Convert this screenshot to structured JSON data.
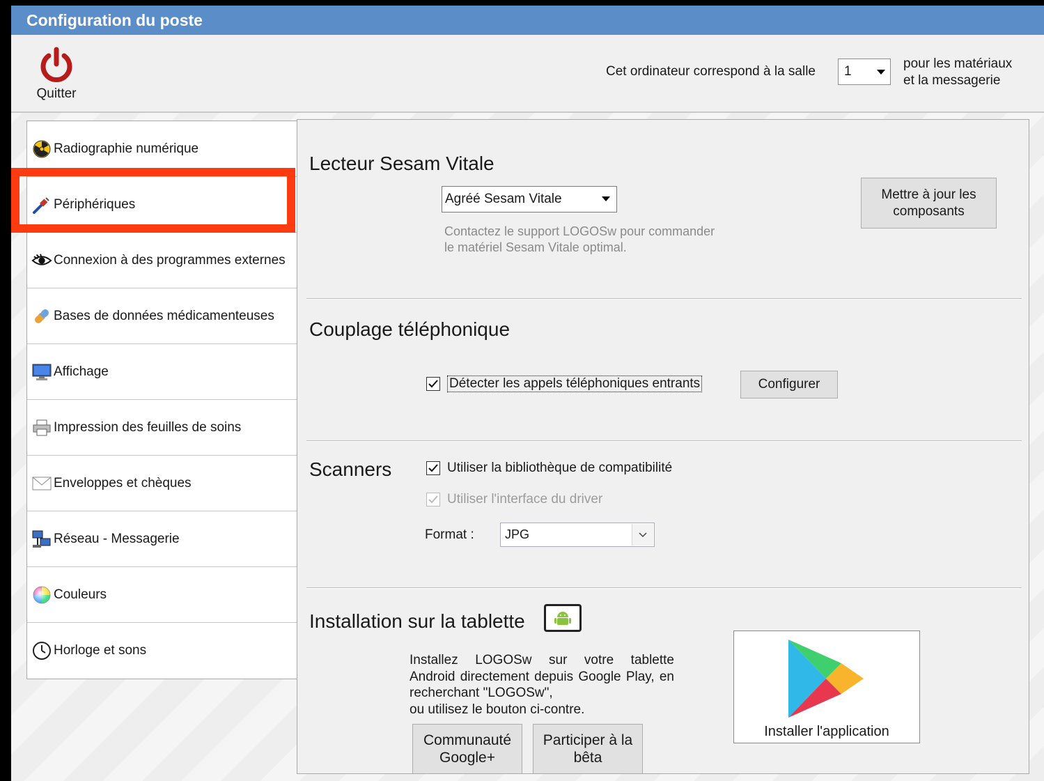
{
  "window": {
    "title": "Configuration du poste"
  },
  "toolbar": {
    "quit_label": "Quitter",
    "salle_text": "Cet ordinateur correspond à la salle",
    "salle_value": "1",
    "salle_after_line1": "pour les matériaux",
    "salle_after_line2": "et la messagerie"
  },
  "sidebar": {
    "items": [
      {
        "label": "Radiographie numérique",
        "icon": "radiation-icon"
      },
      {
        "label": "Périphériques",
        "icon": "plug-icon"
      },
      {
        "label": "Connexion à des programmes externes",
        "icon": "eye-icon"
      },
      {
        "label": "Bases de données médicamenteuses",
        "icon": "pill-icon"
      },
      {
        "label": "Affichage",
        "icon": "monitor-icon"
      },
      {
        "label": "Impression des feuilles de soins",
        "icon": "printer-icon"
      },
      {
        "label": "Enveloppes et chèques",
        "icon": "envelope-icon"
      },
      {
        "label": "Réseau - Messagerie",
        "icon": "network-icon"
      },
      {
        "label": "Couleurs",
        "icon": "color-wheel-icon"
      },
      {
        "label": "Horloge et sons",
        "icon": "clock-icon"
      }
    ],
    "selected": "Périphériques"
  },
  "sesam": {
    "title": "Lecteur Sesam Vitale",
    "select_value": "Agréé Sesam Vitale",
    "help_line1": "Contactez le support LOGOSw pour commander",
    "help_line2": "le matériel Sesam Vitale optimal.",
    "update_line1": "Mettre à jour les",
    "update_line2": "composants"
  },
  "phone": {
    "title": "Couplage téléphonique",
    "detect_label": "Détecter les appels téléphoniques entrants",
    "detect_checked": true,
    "configure_label": "Configurer"
  },
  "scanners": {
    "title": "Scanners",
    "compat_label": "Utiliser la bibliothèque de compatibilité",
    "compat_checked": true,
    "driver_label": "Utiliser l'interface du driver",
    "driver_checked": true,
    "driver_disabled": true,
    "format_label": "Format :",
    "format_value": "JPG"
  },
  "tablet": {
    "title": "Installation sur la tablette",
    "text_line1": "Installez LOGOSw sur votre tablette",
    "text_line2": "Android directement depuis Google Play, en",
    "text_line3": "recherchant \"LOGOSw\",",
    "text_line4": "ou utilisez le bouton ci-contre.",
    "community_line1": "Communauté",
    "community_line2": "Google+",
    "beta_line1": "Participer à la",
    "beta_line2": "bêta",
    "install_label": "Installer l'application"
  },
  "colors": {
    "titlebar": "#5b8ec9",
    "highlight": "#fe3a11"
  }
}
